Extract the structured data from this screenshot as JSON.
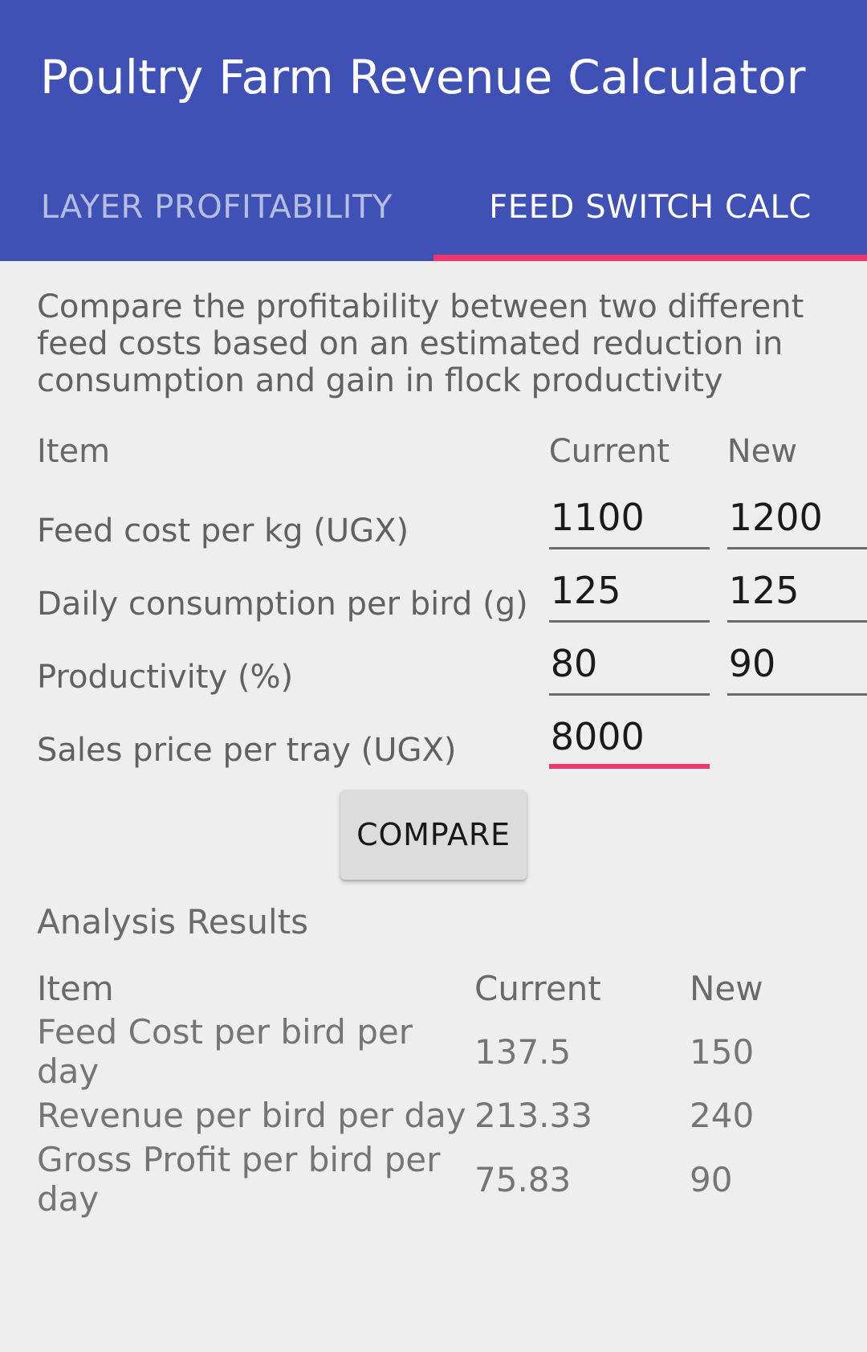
{
  "app": {
    "title": "Poultry Farm Revenue Calculator",
    "accent_blue": "#3f51b5",
    "accent_pink": "#f6336b",
    "background": "#eeeeee"
  },
  "tabs": [
    {
      "label": "LAYER PROFITABILITY",
      "active": false
    },
    {
      "label": "FEED SWITCH CALC",
      "active": true
    }
  ],
  "main": {
    "description": "Compare the profitability between two different feed costs based on an estimated reduction in consumption and gain in flock productivity",
    "inputs": {
      "headers": [
        "Item",
        "Current",
        "New"
      ],
      "rows": [
        {
          "label": "Feed cost per kg (UGX)",
          "current": "1100",
          "new": "1200",
          "focused": false
        },
        {
          "label": "Daily consumption per bird (g)",
          "current": "125",
          "new": "125",
          "focused": false
        },
        {
          "label": "Productivity (%)",
          "current": "80",
          "new": "90",
          "focused": false
        },
        {
          "label": "Sales price per tray (UGX)",
          "current": "8000",
          "new": "",
          "focused": true
        }
      ]
    },
    "compare_label": "COMPARE",
    "results": {
      "title": "Analysis Results",
      "headers": [
        "Item",
        "Current",
        "New"
      ],
      "rows": [
        {
          "label": "Feed Cost per bird per day",
          "current": "137.5",
          "new": "150"
        },
        {
          "label": "Revenue per bird per day",
          "current": "213.33",
          "new": "240"
        },
        {
          "label": "Gross Profit per bird per day",
          "current": "75.83",
          "new": "90"
        }
      ]
    }
  }
}
